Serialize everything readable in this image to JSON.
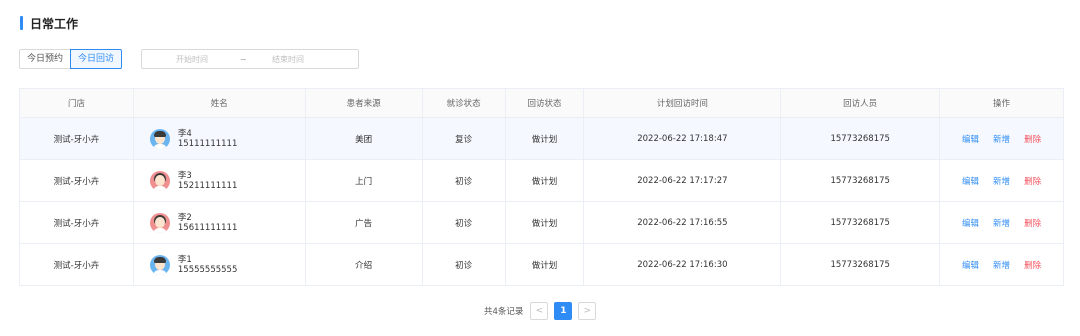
{
  "section": {
    "title": "日常工作"
  },
  "tabs": [
    {
      "label": "今日预约",
      "active": false
    },
    {
      "label": "今日回访",
      "active": true
    }
  ],
  "date_range": {
    "start_placeholder": "开始时间",
    "separator": "~",
    "end_placeholder": "结束时间"
  },
  "table": {
    "headers": {
      "store": "门店",
      "name": "姓名",
      "source": "患者来源",
      "visit_status": "就诊状态",
      "return_status": "回访状态",
      "planned_time": "计划回访时间",
      "staff": "回访人员",
      "ops": "操作"
    },
    "rows": [
      {
        "store": "测试-牙小卉",
        "name": "李4",
        "phone": "15111111111",
        "gender": "male",
        "source": "美团",
        "visit_status": "复诊",
        "return_status": "做计划",
        "planned_time": "2022-06-22 17:18:47",
        "staff": "15773268175"
      },
      {
        "store": "测试-牙小卉",
        "name": "李3",
        "phone": "15211111111",
        "gender": "female",
        "source": "上门",
        "visit_status": "初诊",
        "return_status": "做计划",
        "planned_time": "2022-06-22 17:17:27",
        "staff": "15773268175"
      },
      {
        "store": "测试-牙小卉",
        "name": "李2",
        "phone": "15611111111",
        "gender": "female",
        "source": "广告",
        "visit_status": "初诊",
        "return_status": "做计划",
        "planned_time": "2022-06-22 17:16:55",
        "staff": "15773268175"
      },
      {
        "store": "测试-牙小卉",
        "name": "李1",
        "phone": "15555555555",
        "gender": "male",
        "source": "介绍",
        "visit_status": "初诊",
        "return_status": "做计划",
        "planned_time": "2022-06-22 17:16:30",
        "staff": "15773268175"
      }
    ],
    "actions": {
      "edit": "编辑",
      "add": "新增",
      "delete": "删除"
    }
  },
  "pagination": {
    "total_text": "共4条记录",
    "prev": "<",
    "next": ">",
    "current_page": "1"
  },
  "colors": {
    "accent": "#2f8cf4",
    "danger": "#f5545f",
    "male_avatar": "#6ab4f0",
    "female_avatar": "#f08f8f"
  },
  "icons": {
    "male_avatar": "male-avatar-icon",
    "female_avatar": "female-avatar-icon"
  }
}
